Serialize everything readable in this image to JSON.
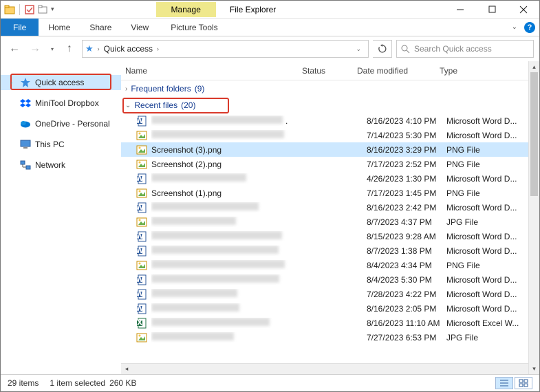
{
  "titlebar": {
    "manage_label": "Manage",
    "title": "File Explorer"
  },
  "ribbon": {
    "file": "File",
    "tabs": [
      "Home",
      "Share",
      "View"
    ],
    "context_tab": "Picture Tools"
  },
  "nav": {
    "breadcrumb": [
      "Quick access"
    ],
    "search_placeholder": "Search Quick access"
  },
  "sidebar": {
    "items": [
      {
        "label": "Quick access",
        "icon": "star",
        "selected": true
      },
      {
        "label": "MiniTool Dropbox",
        "icon": "dropbox"
      },
      {
        "label": "OneDrive - Personal",
        "icon": "onedrive"
      },
      {
        "label": "This PC",
        "icon": "pc"
      },
      {
        "label": "Network",
        "icon": "network"
      }
    ]
  },
  "columns": {
    "name": "Name",
    "status": "Status",
    "date": "Date modified",
    "type": "Type"
  },
  "groups": {
    "frequent": {
      "label": "Frequent folders",
      "count": "(9)"
    },
    "recent": {
      "label": "Recent files",
      "count": "(20)"
    }
  },
  "files": [
    {
      "icon": "word",
      "name": "",
      "dot": ".",
      "date": "8/16/2023 4:10 PM",
      "type": "Microsoft Word D...",
      "blur": true
    },
    {
      "icon": "img",
      "name": "",
      "date": "7/14/2023 5:30 PM",
      "type": "Microsoft Word D...",
      "blur": true
    },
    {
      "icon": "img",
      "name": "Screenshot (3).png",
      "date": "8/16/2023 3:29 PM",
      "type": "PNG File",
      "selected": true
    },
    {
      "icon": "img",
      "name": "Screenshot (2).png",
      "date": "7/17/2023 2:52 PM",
      "type": "PNG File"
    },
    {
      "icon": "word",
      "name": "",
      "date": "4/26/2023 1:30 PM",
      "type": "Microsoft Word D...",
      "blur": true
    },
    {
      "icon": "img",
      "name": "Screenshot (1).png",
      "date": "7/17/2023 1:45 PM",
      "type": "PNG File"
    },
    {
      "icon": "word",
      "name": "",
      "date": "8/16/2023 2:42 PM",
      "type": "Microsoft Word D...",
      "blur": true
    },
    {
      "icon": "img",
      "name": "",
      "date": "8/7/2023 4:37 PM",
      "type": "JPG File",
      "blur": true
    },
    {
      "icon": "word",
      "name": "",
      "date": "8/15/2023 9:28 AM",
      "type": "Microsoft Word D...",
      "blur": true
    },
    {
      "icon": "word",
      "name": "",
      "date": "8/7/2023 1:38 PM",
      "type": "Microsoft Word D...",
      "blur": true
    },
    {
      "icon": "img",
      "name": "",
      "date": "8/4/2023 4:34 PM",
      "type": "PNG File",
      "blur": true
    },
    {
      "icon": "word",
      "name": "",
      "date": "8/4/2023 5:30 PM",
      "type": "Microsoft Word D...",
      "blur": true
    },
    {
      "icon": "word",
      "name": "",
      "date": "7/28/2023 4:22 PM",
      "type": "Microsoft Word D...",
      "blur": true
    },
    {
      "icon": "word",
      "name": "",
      "date": "8/16/2023 2:05 PM",
      "type": "Microsoft Word D...",
      "blur": true
    },
    {
      "icon": "excel",
      "name": "",
      "date": "8/16/2023 11:10 AM",
      "type": "Microsoft Excel W...",
      "blur": true
    },
    {
      "icon": "img",
      "name": "",
      "date": "7/27/2023 6:53 PM",
      "type": "JPG File",
      "blur": true
    }
  ],
  "status": {
    "count": "29 items",
    "selected": "1 item selected",
    "size": "260 KB"
  }
}
